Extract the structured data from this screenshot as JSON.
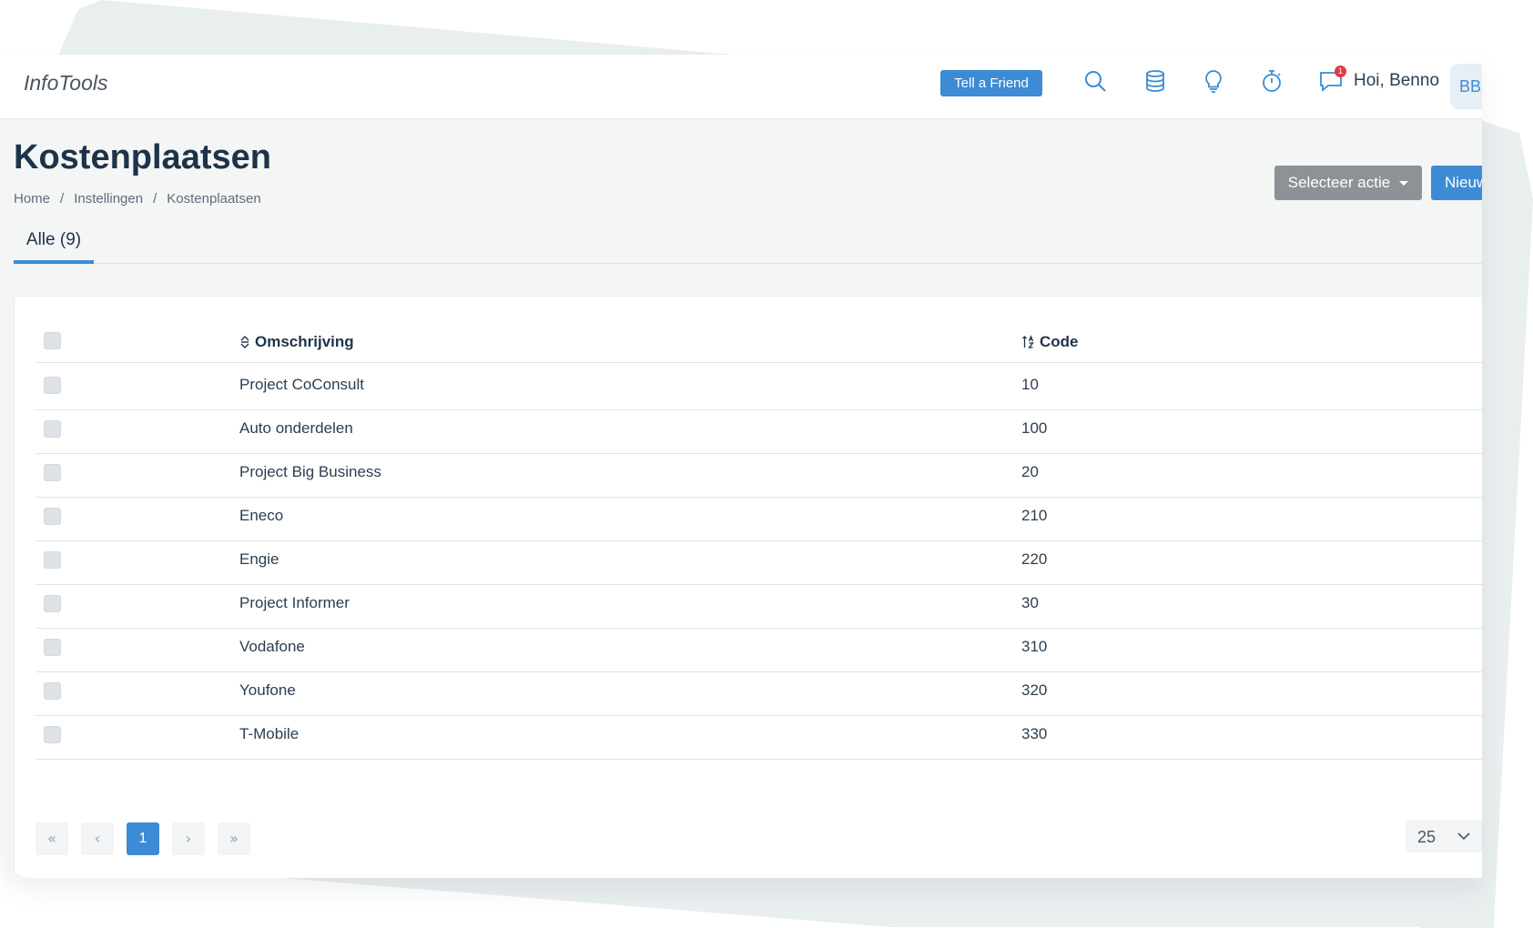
{
  "topbar": {
    "brand": "InfoTools",
    "tell_a_friend": "Tell a Friend",
    "icons": [
      "search-icon",
      "database-icon",
      "lightbulb-icon",
      "stopwatch-icon",
      "chat-icon"
    ],
    "notification_count": "1",
    "greeting": "Hoi, Benno",
    "avatar_initials": "BB"
  },
  "page": {
    "title": "Kostenplaatsen",
    "breadcrumb": [
      "Home",
      "Instellingen",
      "Kostenplaatsen"
    ],
    "breadcrumb_separator": "/",
    "select_action_label": "Selecteer actie",
    "new_label": "Nieuw"
  },
  "tabs": [
    {
      "label": "Alle (9)",
      "active": true
    }
  ],
  "table": {
    "columns": {
      "description": "Omschrijving",
      "code": "Code"
    },
    "rows": [
      {
        "description": "Project CoConsult",
        "code": "10"
      },
      {
        "description": "Auto onderdelen",
        "code": "100"
      },
      {
        "description": "Project Big Business",
        "code": "20"
      },
      {
        "description": "Eneco",
        "code": "210"
      },
      {
        "description": "Engie",
        "code": "220"
      },
      {
        "description": "Project Informer",
        "code": "30"
      },
      {
        "description": "Vodafone",
        "code": "310"
      },
      {
        "description": "Youfone",
        "code": "320"
      },
      {
        "description": "T-Mobile",
        "code": "330"
      }
    ]
  },
  "pagination": {
    "first": "«",
    "prev": "‹",
    "current_page": "1",
    "next": "›",
    "last": "»",
    "per_page": "25"
  },
  "colors": {
    "accent": "#3d8bd4",
    "action_button": "#8d9296",
    "badge": "#e53845",
    "title": "#1d3348"
  }
}
